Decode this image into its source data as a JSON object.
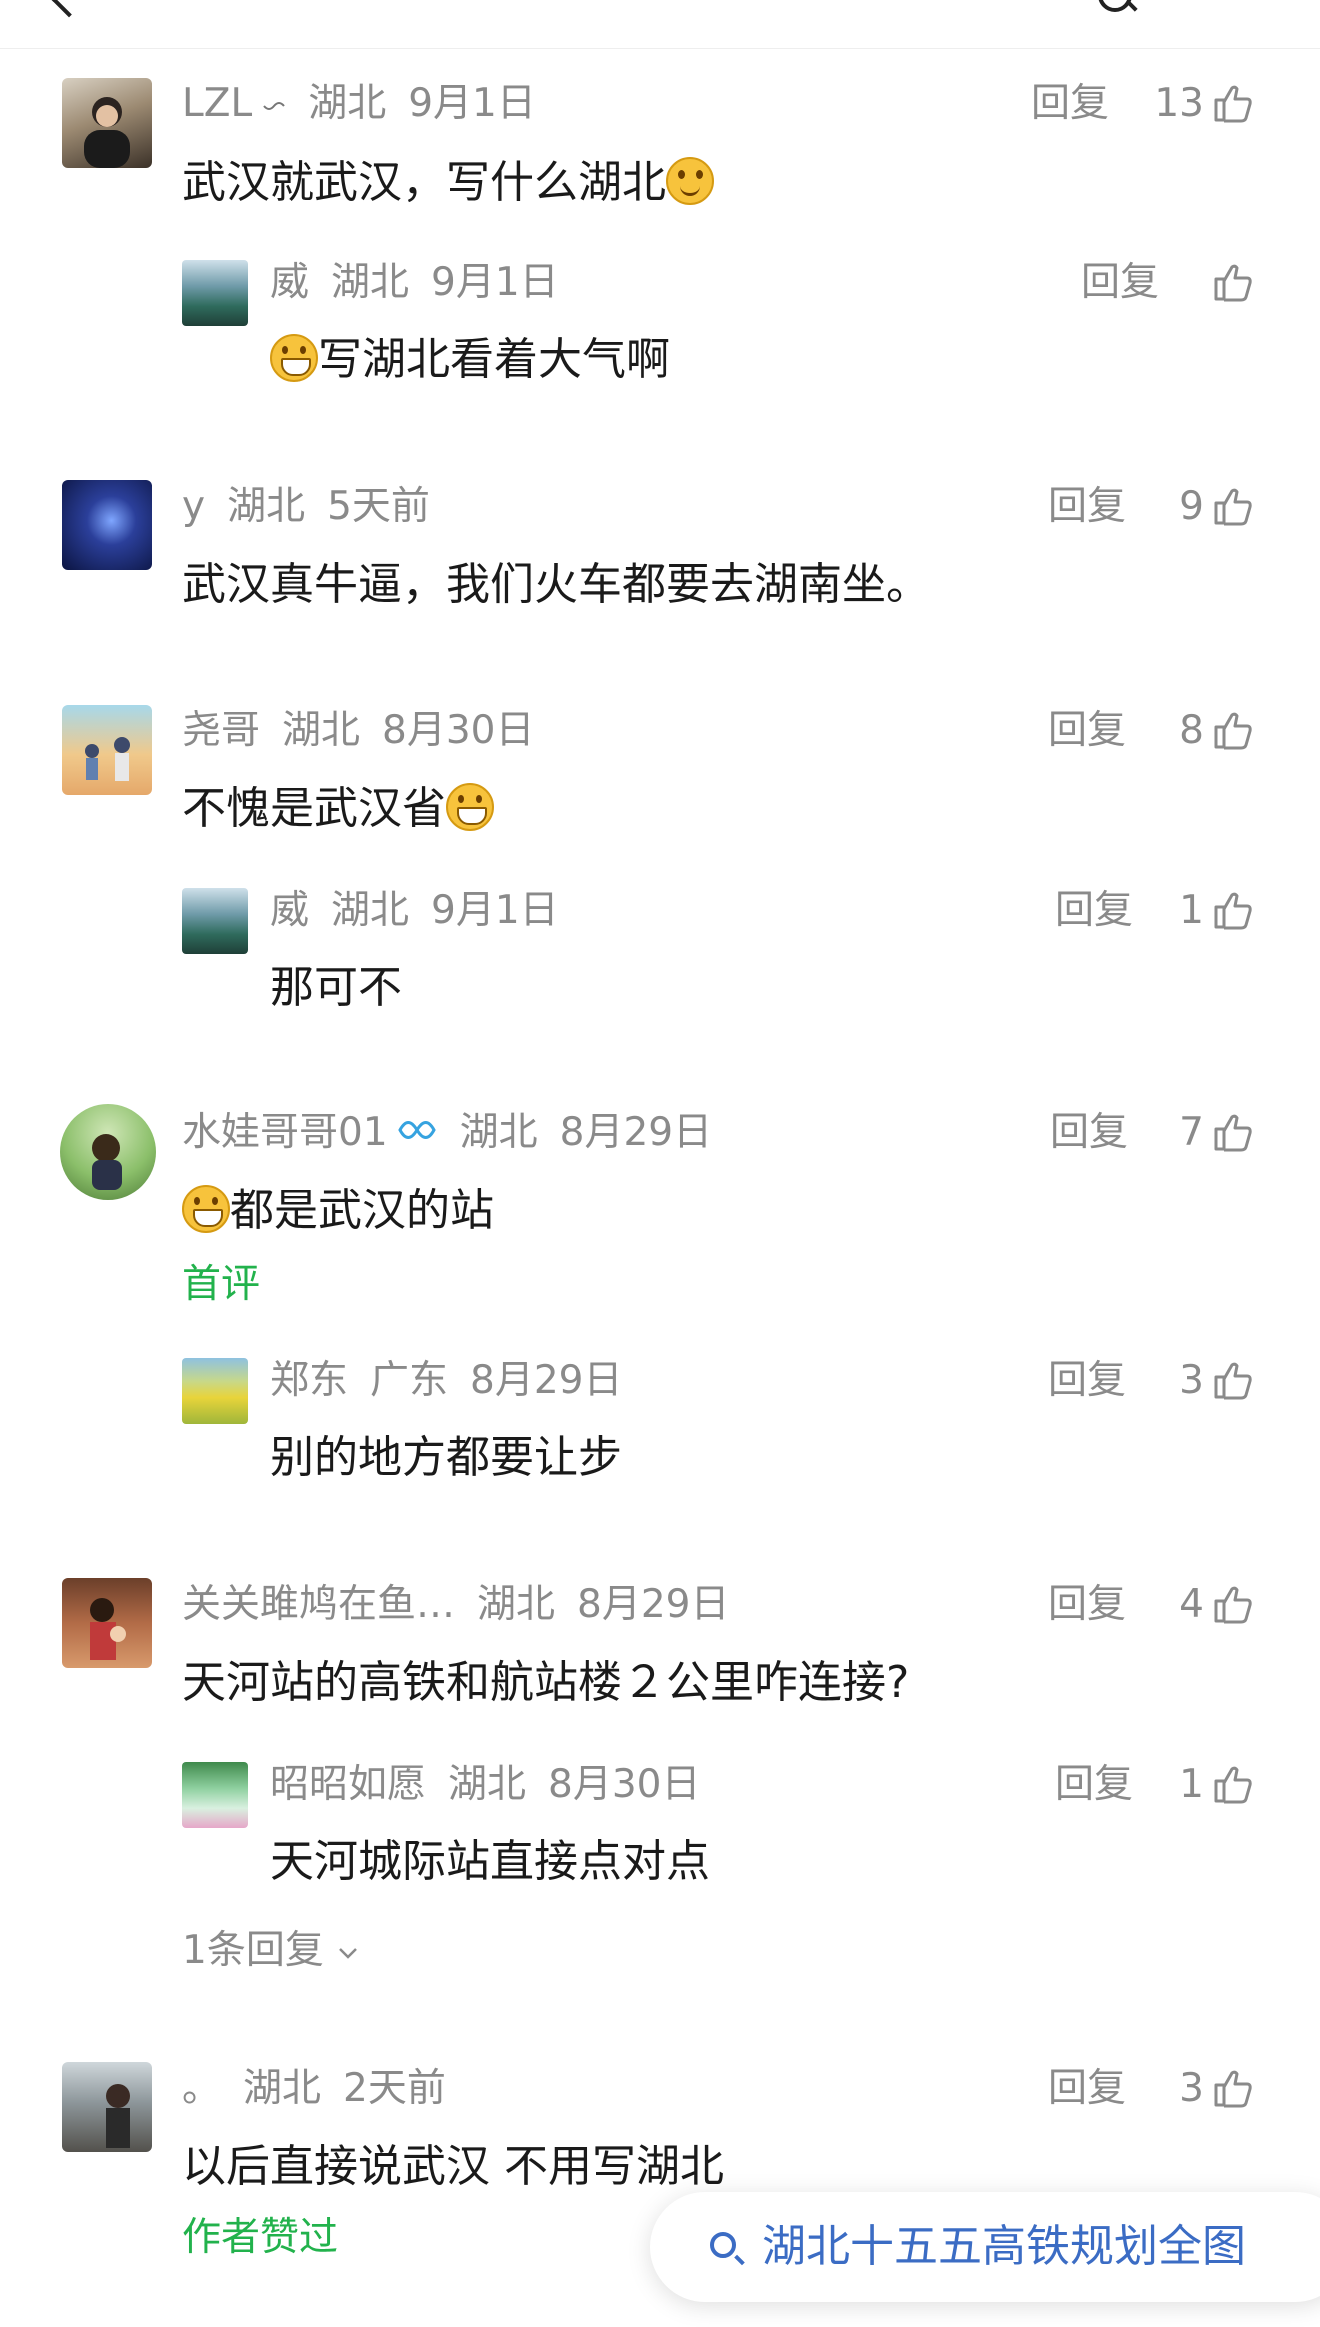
{
  "comments": [
    {
      "name": "LZL",
      "badge": "〰",
      "location": "湖北",
      "time": "9月1日",
      "text": "武汉就武汉，写什么湖北",
      "emoji_after": "smile",
      "reply": "回复",
      "likes": "13"
    },
    {
      "name": "威",
      "location": "湖北",
      "time": "9月1日",
      "emoji_before": "grin",
      "text": "写湖北看着大气啊",
      "reply": "回复",
      "likes": ""
    },
    {
      "name": "y",
      "location": "湖北",
      "time": "5天前",
      "text": "武汉真牛逼，我们火车都要去湖南坐。",
      "reply": "回复",
      "likes": "9"
    },
    {
      "name": "尧哥",
      "location": "湖北",
      "time": "8月30日",
      "text": "不愧是武汉省",
      "emoji_after": "grin",
      "reply": "回复",
      "likes": "8"
    },
    {
      "name": "威",
      "location": "湖北",
      "time": "9月1日",
      "text": "那可不",
      "reply": "回复",
      "likes": "1"
    },
    {
      "name": "水娃哥哥01",
      "badge": "vip-badge",
      "location": "湖北",
      "time": "8月29日",
      "emoji_before": "grin",
      "text": "都是武汉的站",
      "tag": "首评",
      "reply": "回复",
      "likes": "7"
    },
    {
      "name": "郑东",
      "location": "广东",
      "time": "8月29日",
      "text": "别的地方都要让步",
      "reply": "回复",
      "likes": "3"
    },
    {
      "name": "关关雎鸠在鱼…",
      "location": "湖北",
      "time": "8月29日",
      "text": "天河站的高铁和航站楼２公里咋连接?",
      "reply": "回复",
      "likes": "4"
    },
    {
      "name": "昭昭如愿",
      "location": "湖北",
      "time": "8月30日",
      "text": "天河城际站直接点对点",
      "reply": "回复",
      "likes": "1",
      "more": "1条回复"
    },
    {
      "name": "。",
      "location": "湖北",
      "time": "2天前",
      "text": "以后直接说武汉 不用写湖北",
      "tag": "作者赞过",
      "reply": "回复",
      "likes": "3"
    }
  ],
  "search_suggestion": "湖北十五五高铁规划全图",
  "colors": {
    "accent_green": "#22b24c",
    "link_blue": "#3b6cc4",
    "meta_gray": "#8a8a8a"
  }
}
